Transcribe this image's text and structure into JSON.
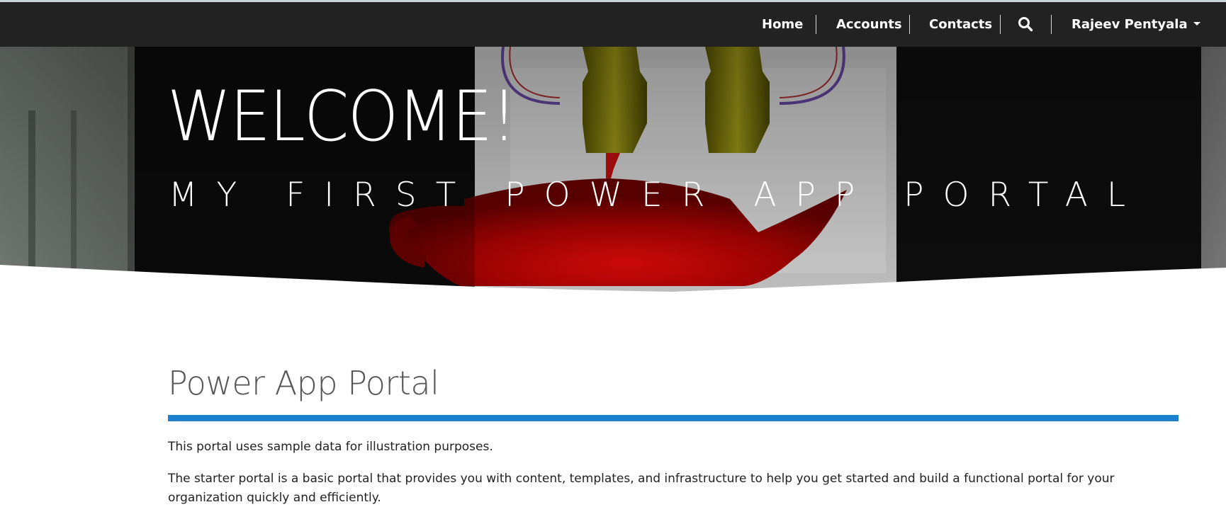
{
  "nav": {
    "items": [
      {
        "label": "Home"
      },
      {
        "label": "Accounts"
      },
      {
        "label": "Contacts"
      }
    ],
    "search_icon": "search-icon",
    "user": {
      "name": "Rajeev Pentyala",
      "caret_icon": "caret-down-icon"
    }
  },
  "hero": {
    "title": "WELCOME!",
    "subtitle": "MY FIRST POWER APP PORTAL",
    "image": "3d-printer-teapot"
  },
  "main": {
    "heading": "Power App Portal",
    "paragraphs": [
      "This portal uses sample data for illustration purposes.",
      "The starter portal is a basic portal that provides you with content, templates, and infrastructure to help you get started and build a functional portal for your organization quickly and efficiently."
    ]
  },
  "colors": {
    "navbar": "#222222",
    "accent_rule": "#1b80cd",
    "heading": "#555555",
    "body_text": "#222222"
  }
}
